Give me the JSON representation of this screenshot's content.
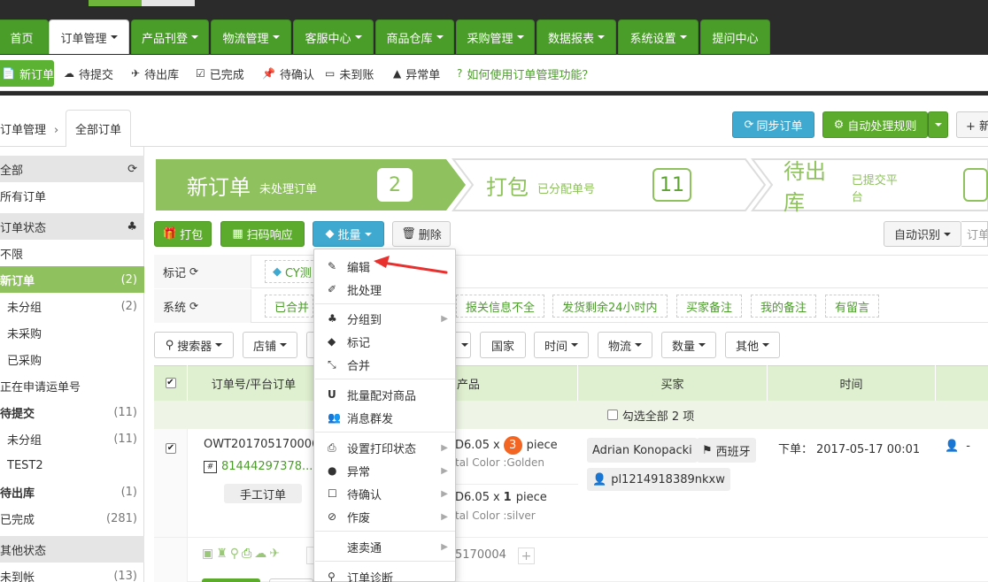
{
  "nav": {
    "tabs": [
      {
        "label": "首页",
        "caret": false
      },
      {
        "label": "订单管理",
        "caret": true
      },
      {
        "label": "产品刊登",
        "caret": true
      },
      {
        "label": "物流管理",
        "caret": true
      },
      {
        "label": "客服中心",
        "caret": true
      },
      {
        "label": "商品仓库",
        "caret": true
      },
      {
        "label": "采购管理",
        "caret": true
      },
      {
        "label": "数据报表",
        "caret": true
      },
      {
        "label": "系统设置",
        "caret": true
      },
      {
        "label": "提问中心",
        "caret": false
      }
    ]
  },
  "subnav": {
    "items": [
      {
        "icon": "📄",
        "label": "新订单"
      },
      {
        "icon": "☁",
        "label": "待提交"
      },
      {
        "icon": "✈",
        "label": "待出库"
      },
      {
        "icon": "☑",
        "label": "已完成"
      },
      {
        "icon": "📌",
        "label": "待确认"
      },
      {
        "icon": "▭",
        "label": "未到账"
      },
      {
        "icon": "▲",
        "label": "异常单"
      }
    ],
    "help": "如何使用订单管理功能？"
  },
  "breadcrumb": {
    "root": "订单管理",
    "sep": "›",
    "tab": "全部订单"
  },
  "toolbar_right": {
    "sync": "同步订单",
    "auto": "自动处理规则",
    "add": "+ 新"
  },
  "sidebar": {
    "rows": [
      {
        "label": "全部",
        "type": "head",
        "icon": "⟳"
      },
      {
        "label": "所有订单",
        "type": "item"
      },
      {
        "label": "订单状态",
        "type": "head",
        "icon": "♣"
      },
      {
        "label": "不限",
        "type": "item"
      },
      {
        "label": "新订单",
        "count": "(2)",
        "type": "active"
      },
      {
        "label": "未分组",
        "count": "(2)",
        "type": "sub"
      },
      {
        "label": "未采购",
        "type": "sub"
      },
      {
        "label": "已采购",
        "type": "sub"
      },
      {
        "label": "正在申请运单号",
        "type": "item"
      },
      {
        "label": "待提交",
        "count": "(11)",
        "type": "bold"
      },
      {
        "label": "未分组",
        "count": "(11)",
        "type": "sub"
      },
      {
        "label": "TEST2",
        "type": "sub"
      },
      {
        "label": "待出库",
        "count": "(1)",
        "type": "bold"
      },
      {
        "label": "已完成",
        "count": "(281)",
        "type": "item"
      },
      {
        "label": "其他状态",
        "type": "head"
      },
      {
        "label": "未到帐",
        "count": "(13)",
        "type": "item"
      }
    ]
  },
  "pipeline": {
    "steps": [
      {
        "title": "新订单",
        "sub": "未处理订单",
        "count": "2"
      },
      {
        "title": "打包",
        "sub": "已分配单号",
        "count": "11"
      },
      {
        "title": "待出库",
        "sub": "已提交平台",
        "count": ""
      }
    ]
  },
  "actions": {
    "pack": "打包",
    "scan": "扫码响应",
    "batch": "批量",
    "delete": "删除",
    "auto_identify": "自动识别",
    "order_placeholder": "订单"
  },
  "filters": {
    "mark_label": "标记",
    "mark_tag": "CY测",
    "system_label": "系统",
    "system_tags": [
      "已合并",
      "报关信息不全",
      "发货剩余24小时内",
      "买家备注",
      "我的备注",
      "有留言"
    ]
  },
  "filter_buttons": [
    "搜索器",
    "店铺",
    "国家",
    "时间",
    "物流",
    "数量",
    "其他"
  ],
  "table": {
    "headers": [
      "订单号/平台订单",
      "产品",
      "买家",
      "时间"
    ],
    "select_all": "勾选全部 2 项"
  },
  "order": {
    "order_no": "OWT201705170006",
    "platform_no": "81444297378...",
    "manual": "手工订单",
    "items": [
      {
        "price": "6.05",
        "qty": "3",
        "unit": "piece",
        "attr": "tal Color :Golden"
      },
      {
        "price": "6.05",
        "qty": "1",
        "unit": "piece",
        "attr": "tal Color :silver"
      }
    ],
    "buyer_name": "Adrian Konopacki",
    "country": "西班牙",
    "buyer_id": "pl1214918389nkxw",
    "time_label": "下单：",
    "time_value": "2017-05-17 00:01",
    "dash": "-",
    "footer_no": "5170004"
  },
  "batch_menu": {
    "items": [
      {
        "icon": "✎",
        "label": "编辑",
        "arrow": false
      },
      {
        "icon": "✐",
        "label": "批处理",
        "arrow": false
      },
      {
        "icon": "♣",
        "label": "分组到",
        "arrow": true
      },
      {
        "icon": "◆",
        "label": "标记",
        "arrow": false
      },
      {
        "icon": "⤡",
        "label": "合并",
        "arrow": false
      },
      {
        "icon": "U",
        "label": "批量配对商品",
        "arrow": false
      },
      {
        "icon": "👥",
        "label": "消息群发",
        "arrow": false
      },
      {
        "icon": "⎙",
        "label": "设置打印状态",
        "arrow": true
      },
      {
        "icon": "●",
        "label": "异常",
        "arrow": true
      },
      {
        "icon": "☐",
        "label": "待确认",
        "arrow": true
      },
      {
        "icon": "⊘",
        "label": "作废",
        "arrow": true
      },
      {
        "icon": "",
        "label": "速卖通",
        "arrow": true
      },
      {
        "icon": "⚲",
        "label": "订单诊断",
        "arrow": false
      }
    ]
  },
  "colors": {
    "brand_green": "#4b9d2a",
    "accent_red": "#e8312f",
    "info_blue": "#3fa9d0"
  }
}
